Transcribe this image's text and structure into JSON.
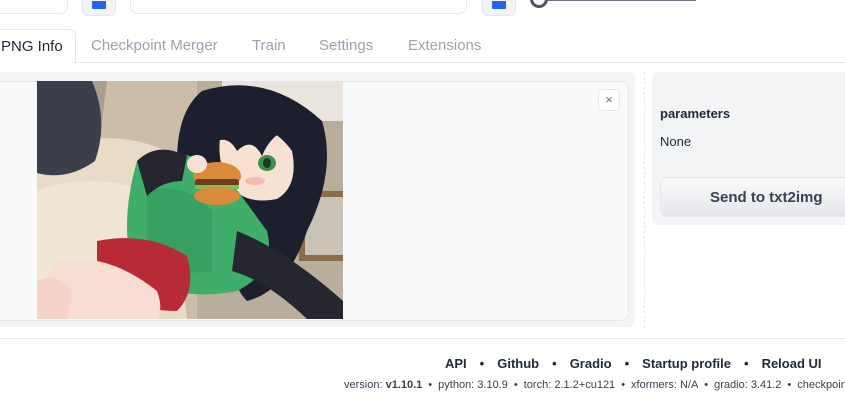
{
  "tabs": [
    {
      "label": "PNG Info",
      "active": true
    },
    {
      "label": "Checkpoint Merger",
      "active": false
    },
    {
      "label": "Train",
      "active": false
    },
    {
      "label": "Settings",
      "active": false
    },
    {
      "label": "Extensions",
      "active": false
    }
  ],
  "image_panel": {
    "close_symbol": "×"
  },
  "parameters": {
    "label": "parameters",
    "value": "None",
    "send_button": "Send to txt2img"
  },
  "footer": {
    "links": [
      "API",
      "Github",
      "Gradio",
      "Startup profile",
      "Reload UI"
    ],
    "separator": "•",
    "version_label": "version:",
    "version_value": "v1.10.1",
    "python": "python: 3.10.9",
    "torch": "torch: 2.1.2+cu121",
    "xformers": "xformers: N/A",
    "gradio": "gradio: 3.41.2",
    "checkpoint": "checkpoint:"
  },
  "colors": {
    "accent": "#2563eb",
    "shirt": "#3fae6b",
    "hair": "#1e1f2e"
  }
}
